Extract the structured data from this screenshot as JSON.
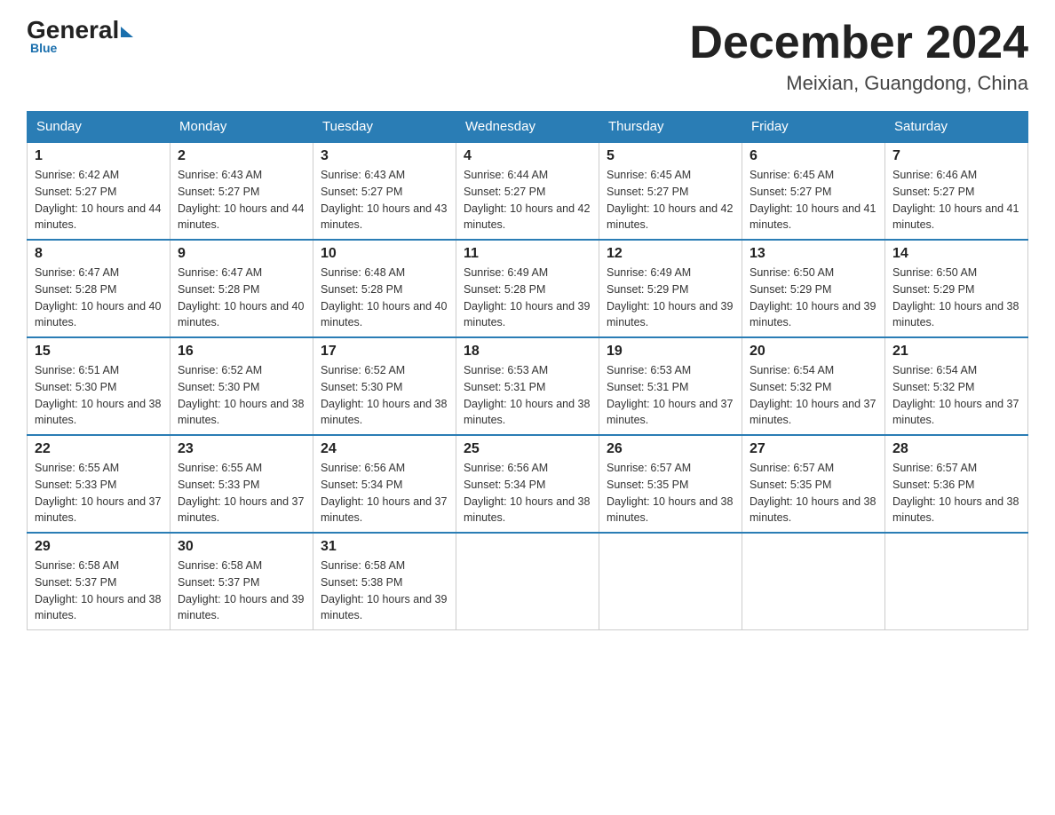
{
  "logo": {
    "general": "General",
    "blue": "Blue",
    "underline": "Blue"
  },
  "title": "December 2024",
  "subtitle": "Meixian, Guangdong, China",
  "days_of_week": [
    "Sunday",
    "Monday",
    "Tuesday",
    "Wednesday",
    "Thursday",
    "Friday",
    "Saturday"
  ],
  "weeks": [
    [
      {
        "day": 1,
        "sunrise": "6:42 AM",
        "sunset": "5:27 PM",
        "daylight": "10 hours and 44 minutes."
      },
      {
        "day": 2,
        "sunrise": "6:43 AM",
        "sunset": "5:27 PM",
        "daylight": "10 hours and 44 minutes."
      },
      {
        "day": 3,
        "sunrise": "6:43 AM",
        "sunset": "5:27 PM",
        "daylight": "10 hours and 43 minutes."
      },
      {
        "day": 4,
        "sunrise": "6:44 AM",
        "sunset": "5:27 PM",
        "daylight": "10 hours and 42 minutes."
      },
      {
        "day": 5,
        "sunrise": "6:45 AM",
        "sunset": "5:27 PM",
        "daylight": "10 hours and 42 minutes."
      },
      {
        "day": 6,
        "sunrise": "6:45 AM",
        "sunset": "5:27 PM",
        "daylight": "10 hours and 41 minutes."
      },
      {
        "day": 7,
        "sunrise": "6:46 AM",
        "sunset": "5:27 PM",
        "daylight": "10 hours and 41 minutes."
      }
    ],
    [
      {
        "day": 8,
        "sunrise": "6:47 AM",
        "sunset": "5:28 PM",
        "daylight": "10 hours and 40 minutes."
      },
      {
        "day": 9,
        "sunrise": "6:47 AM",
        "sunset": "5:28 PM",
        "daylight": "10 hours and 40 minutes."
      },
      {
        "day": 10,
        "sunrise": "6:48 AM",
        "sunset": "5:28 PM",
        "daylight": "10 hours and 40 minutes."
      },
      {
        "day": 11,
        "sunrise": "6:49 AM",
        "sunset": "5:28 PM",
        "daylight": "10 hours and 39 minutes."
      },
      {
        "day": 12,
        "sunrise": "6:49 AM",
        "sunset": "5:29 PM",
        "daylight": "10 hours and 39 minutes."
      },
      {
        "day": 13,
        "sunrise": "6:50 AM",
        "sunset": "5:29 PM",
        "daylight": "10 hours and 39 minutes."
      },
      {
        "day": 14,
        "sunrise": "6:50 AM",
        "sunset": "5:29 PM",
        "daylight": "10 hours and 38 minutes."
      }
    ],
    [
      {
        "day": 15,
        "sunrise": "6:51 AM",
        "sunset": "5:30 PM",
        "daylight": "10 hours and 38 minutes."
      },
      {
        "day": 16,
        "sunrise": "6:52 AM",
        "sunset": "5:30 PM",
        "daylight": "10 hours and 38 minutes."
      },
      {
        "day": 17,
        "sunrise": "6:52 AM",
        "sunset": "5:30 PM",
        "daylight": "10 hours and 38 minutes."
      },
      {
        "day": 18,
        "sunrise": "6:53 AM",
        "sunset": "5:31 PM",
        "daylight": "10 hours and 38 minutes."
      },
      {
        "day": 19,
        "sunrise": "6:53 AM",
        "sunset": "5:31 PM",
        "daylight": "10 hours and 37 minutes."
      },
      {
        "day": 20,
        "sunrise": "6:54 AM",
        "sunset": "5:32 PM",
        "daylight": "10 hours and 37 minutes."
      },
      {
        "day": 21,
        "sunrise": "6:54 AM",
        "sunset": "5:32 PM",
        "daylight": "10 hours and 37 minutes."
      }
    ],
    [
      {
        "day": 22,
        "sunrise": "6:55 AM",
        "sunset": "5:33 PM",
        "daylight": "10 hours and 37 minutes."
      },
      {
        "day": 23,
        "sunrise": "6:55 AM",
        "sunset": "5:33 PM",
        "daylight": "10 hours and 37 minutes."
      },
      {
        "day": 24,
        "sunrise": "6:56 AM",
        "sunset": "5:34 PM",
        "daylight": "10 hours and 37 minutes."
      },
      {
        "day": 25,
        "sunrise": "6:56 AM",
        "sunset": "5:34 PM",
        "daylight": "10 hours and 38 minutes."
      },
      {
        "day": 26,
        "sunrise": "6:57 AM",
        "sunset": "5:35 PM",
        "daylight": "10 hours and 38 minutes."
      },
      {
        "day": 27,
        "sunrise": "6:57 AM",
        "sunset": "5:35 PM",
        "daylight": "10 hours and 38 minutes."
      },
      {
        "day": 28,
        "sunrise": "6:57 AM",
        "sunset": "5:36 PM",
        "daylight": "10 hours and 38 minutes."
      }
    ],
    [
      {
        "day": 29,
        "sunrise": "6:58 AM",
        "sunset": "5:37 PM",
        "daylight": "10 hours and 38 minutes."
      },
      {
        "day": 30,
        "sunrise": "6:58 AM",
        "sunset": "5:37 PM",
        "daylight": "10 hours and 39 minutes."
      },
      {
        "day": 31,
        "sunrise": "6:58 AM",
        "sunset": "5:38 PM",
        "daylight": "10 hours and 39 minutes."
      },
      null,
      null,
      null,
      null
    ]
  ]
}
